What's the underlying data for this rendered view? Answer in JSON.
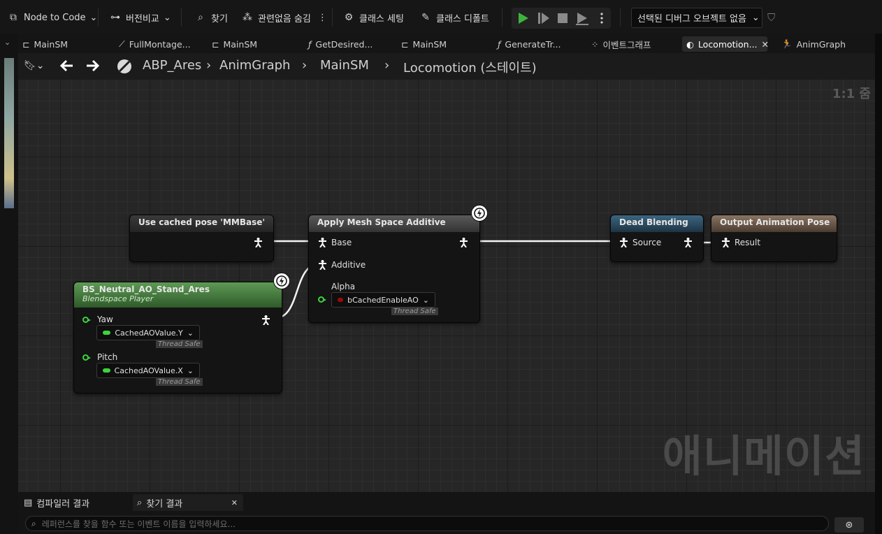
{
  "toolbar": {
    "node_to_code": "Node to Code",
    "diff": "버전비교",
    "find": "찾기",
    "hide_unrelated": "관련없음 숨김",
    "class_settings": "클래스 세팅",
    "class_defaults": "클래스 디폴트",
    "debug_object": "선택된 디버그 오브젝트 없음"
  },
  "tabs": [
    {
      "label": "MainSM",
      "icon": "state-machine-icon"
    },
    {
      "label": "FullMontage...",
      "icon": "pencil-icon"
    },
    {
      "label": "MainSM",
      "icon": "state-machine-icon"
    },
    {
      "label": "GetDesired...",
      "icon": "function-icon"
    },
    {
      "label": "MainSM",
      "icon": "state-machine-icon"
    },
    {
      "label": "GenerateTr...",
      "icon": "function-icon"
    },
    {
      "label": "이벤트그래프",
      "icon": "event-graph-icon"
    },
    {
      "label": "Locomotion...",
      "icon": "state-icon",
      "active": true
    },
    {
      "label": "AnimGraph",
      "icon": "running-man-icon"
    }
  ],
  "breadcrumb": {
    "items": [
      "ABP_Ares",
      "AnimGraph",
      "MainSM",
      "Locomotion (스테이트)"
    ],
    "zoom": "1:1 줌"
  },
  "graph": {
    "watermark": "애니메이션",
    "nodes": {
      "cached_pose": {
        "title": "Use cached pose 'MMBase'"
      },
      "blendspace": {
        "title": "BS_Neutral_AO_Stand_Ares",
        "subtitle": "Blendspace Player",
        "pins": [
          {
            "label": "Yaw",
            "value": "CachedAOValue.Y",
            "thread": "Thread Safe"
          },
          {
            "label": "Pitch",
            "value": "CachedAOValue.X",
            "thread": "Thread Safe"
          }
        ]
      },
      "apply_additive": {
        "title": "Apply Mesh Space Additive",
        "base": "Base",
        "additive": "Additive",
        "alpha": "Alpha",
        "alpha_value": "bCachedEnableAO",
        "thread": "Thread Safe"
      },
      "dead_blending": {
        "title": "Dead Blending",
        "source": "Source"
      },
      "output_pose": {
        "title": "Output Animation Pose",
        "result": "Result"
      }
    }
  },
  "bottom": {
    "tabs": [
      "컴파일러 결과",
      "찾기 결과"
    ],
    "search_placeholder": "레퍼런스를 찾을 함수 또는 이벤트 이름을 입력하세요..."
  },
  "colors": {
    "blendspace_header": "#4d7a45",
    "dead_blending_header": "#2d4a5e",
    "output_header": "#6e5a4a",
    "float_pin": "#3cd43c",
    "bool_pin": "#9a0a0a"
  }
}
